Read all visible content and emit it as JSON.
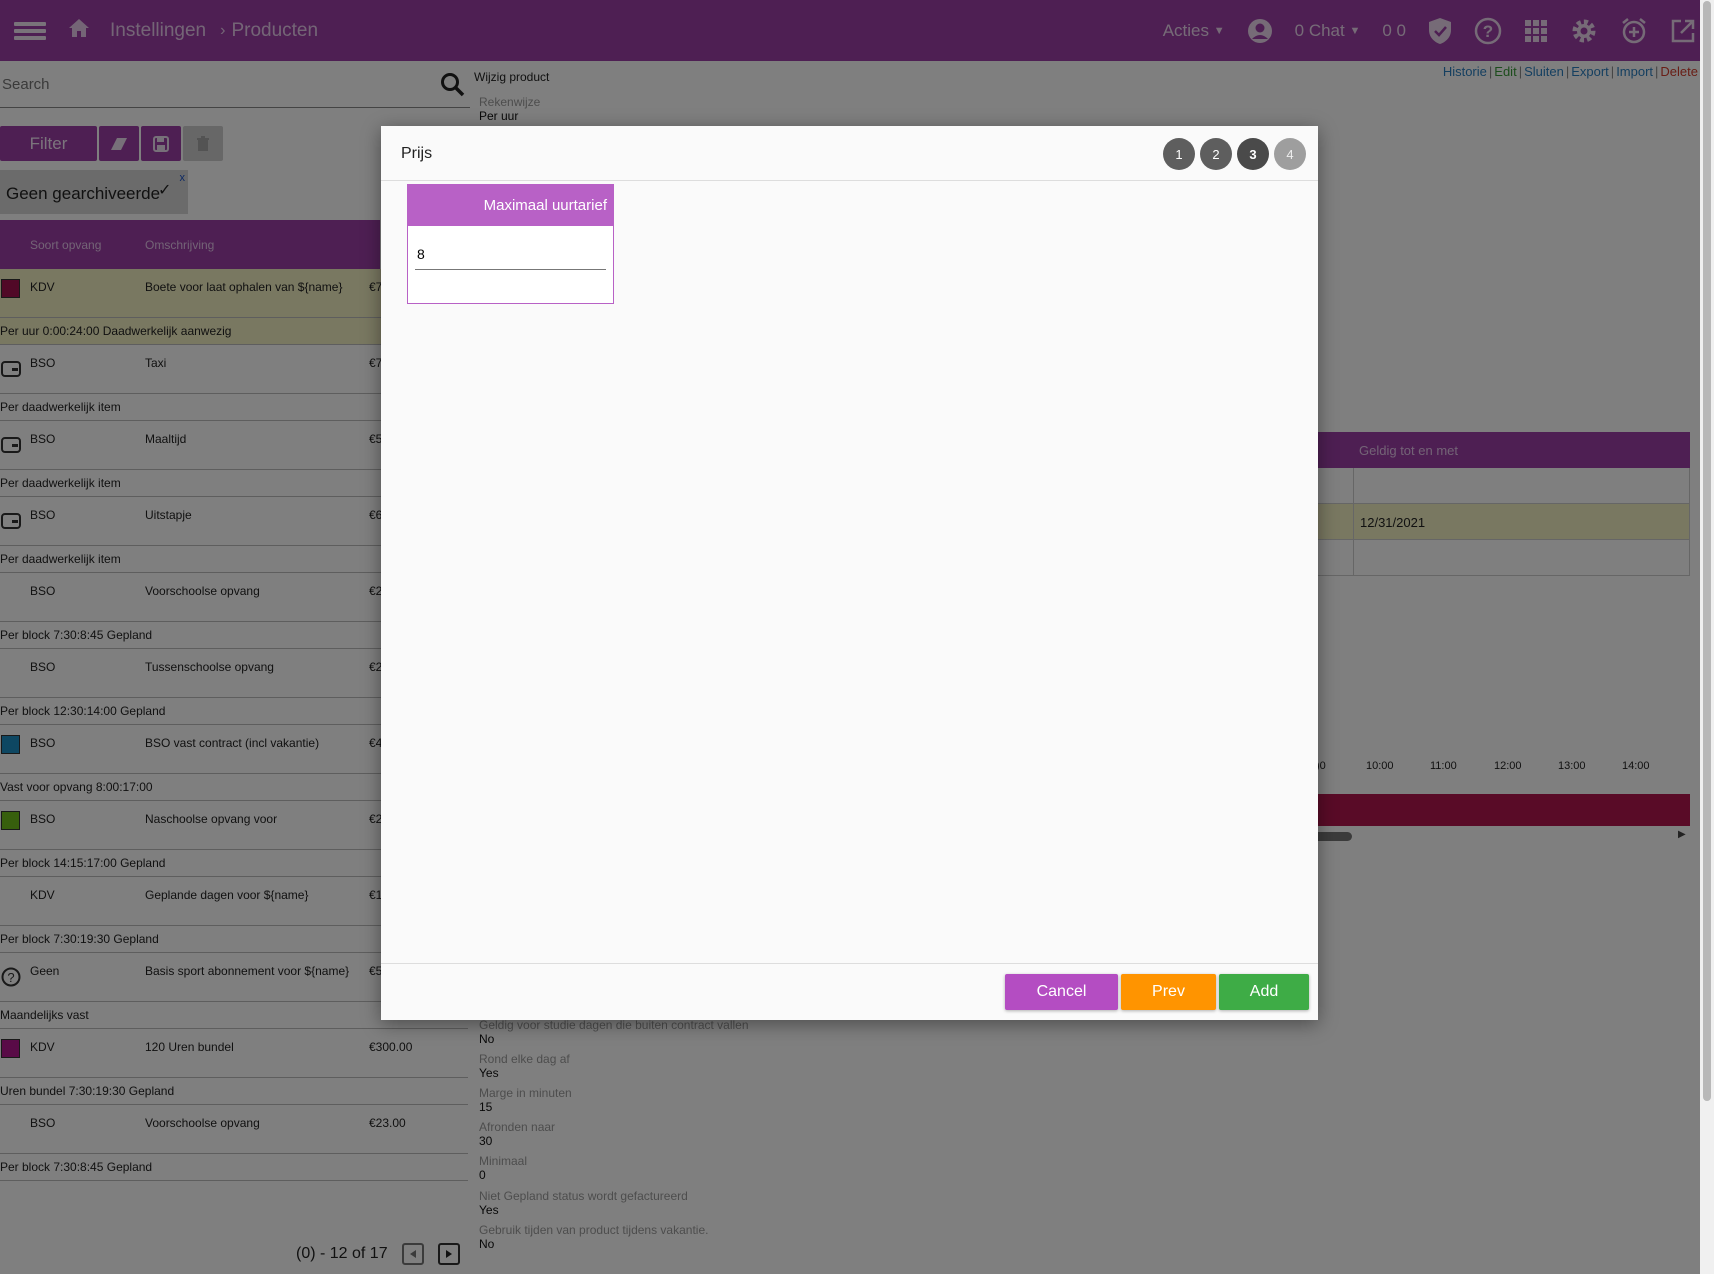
{
  "header": {
    "breadcrumb_1": "Instellingen",
    "breadcrumb_2": "Producten",
    "acties": "Acties",
    "chat": "0 Chat",
    "counter": "0 0"
  },
  "search": {
    "placeholder": "Search"
  },
  "filter": {
    "label": "Filter",
    "chip": "Geen gearchiveerde",
    "chip_close": "x"
  },
  "table": {
    "col_soort": "Soort opvang",
    "col_omschrijving": "Omschrijving",
    "rows": [
      {
        "soort": "KDV",
        "omschrijving": "Boete voor laat ophalen van ${name}",
        "prijs": "€7",
        "sub": "Per uur 0:00:24:00 Daadwerkelijk aanwezig",
        "swatch": "#a3134f",
        "icon": ""
      },
      {
        "soort": "BSO",
        "omschrijving": "Taxi",
        "prijs": "€7",
        "sub": "Per daadwerkelijk item",
        "swatch": "",
        "icon": "wallet-icon"
      },
      {
        "soort": "BSO",
        "omschrijving": "Maaltijd",
        "prijs": "€5",
        "sub": "Per daadwerkelijk item",
        "swatch": "",
        "icon": "wallet-icon"
      },
      {
        "soort": "BSO",
        "omschrijving": "Uitstapje",
        "prijs": "€6",
        "sub": "Per daadwerkelijk item",
        "swatch": "",
        "icon": "wallet-icon"
      },
      {
        "soort": "BSO",
        "omschrijving": "Voorschoolse opvang",
        "prijs": "€2",
        "sub": "Per block 7:30:8:45 Gepland",
        "swatch": "",
        "icon": ""
      },
      {
        "soort": "BSO",
        "omschrijving": "Tussenschoolse opvang",
        "prijs": "€2",
        "sub": "Per block 12:30:14:00 Gepland",
        "swatch": "",
        "icon": ""
      },
      {
        "soort": "BSO",
        "omschrijving": "BSO vast contract (incl vakantie)",
        "prijs": "€4",
        "sub": "Vast voor opvang 8:00:17:00",
        "swatch": "#1d8fc4",
        "icon": ""
      },
      {
        "soort": "BSO",
        "omschrijving": "Naschoolse opvang voor",
        "prijs": "€2",
        "sub": "Per block 14:15:17:00 Gepland",
        "swatch": "#6fbf1a",
        "icon": ""
      },
      {
        "soort": "KDV",
        "omschrijving": "Geplande dagen voor ${name}",
        "prijs": "€1",
        "sub": "Per block 7:30:19:30 Gepland",
        "swatch": "",
        "icon": ""
      },
      {
        "soort": "Geen",
        "omschrijving": "Basis sport abonnement voor ${name}",
        "prijs": "€5",
        "sub": "Maandelijks vast",
        "swatch": "",
        "icon": "help-circle-icon"
      },
      {
        "soort": "KDV",
        "omschrijving": "120 Uren bundel",
        "prijs": "€300.00",
        "sub": "Uren bundel 7:30:19:30 Gepland",
        "swatch": "#b3168f",
        "icon": ""
      },
      {
        "soort": "BSO",
        "omschrijving": "Voorschoolse opvang",
        "prijs": "€23.00",
        "sub": "Per block 7:30:8:45 Gepland",
        "swatch": "",
        "icon": ""
      }
    ]
  },
  "pager": {
    "text": "(0) - 12 of 17"
  },
  "detail": {
    "title": "Wijzig product",
    "fields": [
      {
        "label": "Rekenwijze",
        "value": "Per uur"
      },
      {
        "label": "Geldig voor studie dagen die buiten contract vallen",
        "value": "No"
      },
      {
        "label": "Rond elke dag af",
        "value": "Yes"
      },
      {
        "label": "Marge in minuten",
        "value": "15"
      },
      {
        "label": "Afronden naar",
        "value": "30"
      },
      {
        "label": "Minimaal",
        "value": "0"
      },
      {
        "label": "Niet Gepland status wordt gefactureerd",
        "value": "Yes"
      },
      {
        "label": "Gebruik tijden van product tijdens vakantie.",
        "value": "No"
      }
    ]
  },
  "links": {
    "historie": "Historie",
    "edit": "Edit",
    "sluiten": "Sluiten",
    "export": "Export",
    "import": "Import",
    "delete": "Delete",
    "sep": "|"
  },
  "right_grid": {
    "header": "Geldig tot en met",
    "row2": "12/31/2021"
  },
  "timeline": {
    "ticks": [
      ")0",
      "10:00",
      "11:00",
      "12:00",
      "13:00",
      "14:00"
    ]
  },
  "dialog": {
    "title": "Prijs",
    "steps": [
      "1",
      "2",
      "3",
      "4"
    ],
    "box_header": "Maximaal uurtarief",
    "value": "8",
    "cancel": "Cancel",
    "prev": "Prev",
    "add": "Add"
  },
  "colors": {
    "brand": "#9c3fa6",
    "accent": "#b861c6",
    "cancel": "#b44dc2",
    "prev": "#ff9400",
    "add": "#3eac46"
  }
}
